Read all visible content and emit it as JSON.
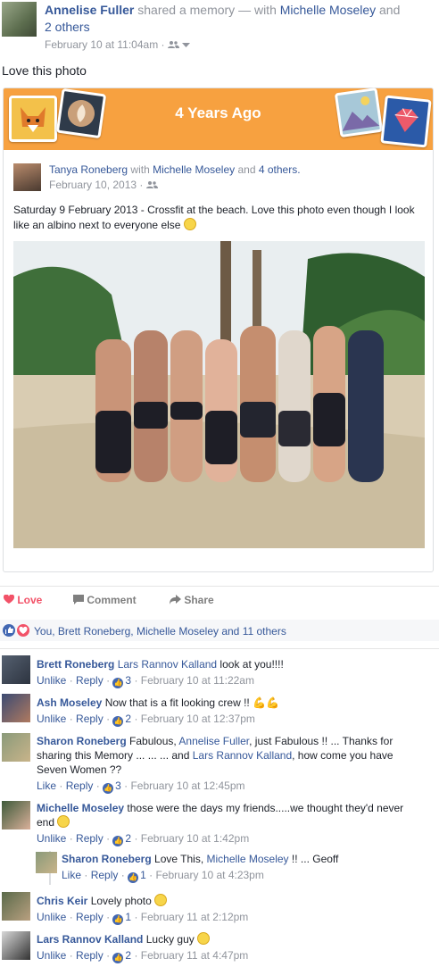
{
  "post": {
    "author": "Annelise Fuller",
    "action": "shared a memory — with",
    "tagged": "Michelle Moseley",
    "and": "and",
    "others_link": "2 others",
    "timestamp": "February 10 at 11:04am",
    "text": "Love this photo"
  },
  "memory": {
    "banner_title": "4 Years Ago",
    "inner_author": "Tanya Roneberg",
    "inner_with": "with",
    "inner_tagged": "Michelle Moseley",
    "inner_and": "and",
    "inner_others": "4 others.",
    "inner_date": "February 10, 2013",
    "inner_text": "Saturday 9 February 2013 - Crossfit at the beach. Love this photo even though I look like an albino next to everyone else"
  },
  "actions": {
    "love": "Love",
    "comment": "Comment",
    "share": "Share"
  },
  "reactions_text": "You, Brett Roneberg, Michelle Moseley and 11 others",
  "comments": [
    {
      "name": "Brett Roneberg",
      "text_link": "Lars Rannov Kalland",
      "text": " look at you!!!!",
      "action": "Unlike",
      "reply": "Reply",
      "likes": "3",
      "time": "February 10 at 11:22am"
    },
    {
      "name": "Ash Moseley",
      "text": "Now that is a fit looking crew !!",
      "action": "Unlike",
      "reply": "Reply",
      "likes": "2",
      "time": "February 10 at 12:37pm"
    },
    {
      "name": "Sharon Roneberg",
      "text_a": "Fabulous, ",
      "link_a": "Annelise Fuller",
      "text_b": ", just Fabulous !! ... Thanks for",
      "text_c": "sharing this Memory ... ... ... and ",
      "link_b": "Lars Rannov Kalland",
      "text_d": ", how come you have",
      "text_e": "Seven Women ??",
      "action": "Like",
      "reply": "Reply",
      "likes": "3",
      "time": "February 10 at 12:45pm"
    },
    {
      "name": "Michelle Moseley",
      "text": "those were the days my friends.....we thought they'd never",
      "text_2": "end",
      "action": "Unlike",
      "reply": "Reply",
      "likes": "2",
      "time": "February 10 at 1:42pm"
    },
    {
      "name": "Sharon Roneberg",
      "text_a": "Love This, ",
      "link_a": "Michelle Moseley",
      "text_b": " !! ... Geoff",
      "action": "Like",
      "reply": "Reply",
      "likes": "1",
      "time": "February 10 at 4:23pm"
    },
    {
      "name": "Chris Keir",
      "text": "Lovely photo",
      "action": "Unlike",
      "reply": "Reply",
      "likes": "1",
      "time": "February 11 at 2:12pm"
    },
    {
      "name": "Lars Rannov Kalland",
      "text": "Lucky guy",
      "action": "Unlike",
      "reply": "Reply",
      "likes": "2",
      "time": "February 11 at 4:47pm"
    }
  ],
  "sep": "·",
  "colors": {
    "link": "#365899",
    "banner": "#f7a140",
    "love": "#f25268",
    "like": "#4267b2"
  }
}
